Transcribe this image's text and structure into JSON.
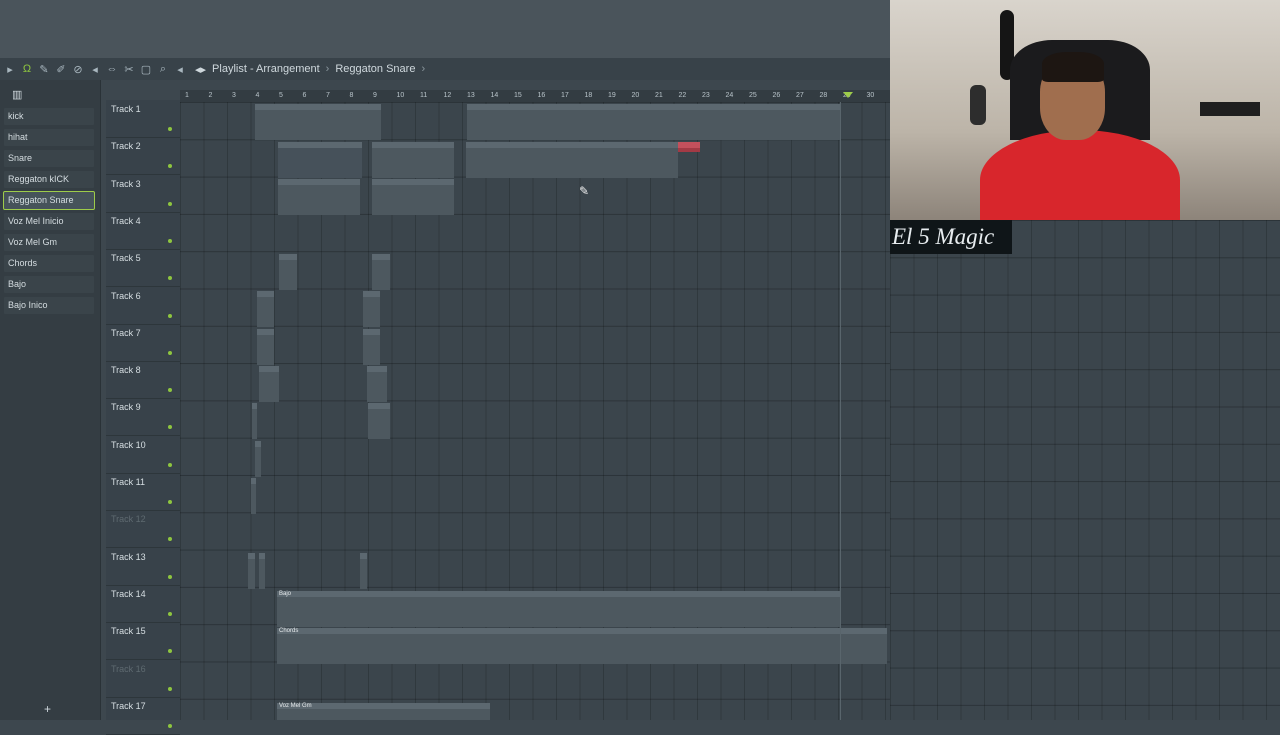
{
  "window": {
    "breadcrumbs": [
      "Playlist - Arrangement",
      "Reggaton Snare"
    ]
  },
  "browser": {
    "header_icon": "piano-roll-icon",
    "items": [
      {
        "label": "kick",
        "active": false
      },
      {
        "label": "hihat",
        "active": false
      },
      {
        "label": "Snare",
        "active": false
      },
      {
        "label": "Reggaton kICK",
        "active": false
      },
      {
        "label": "Reggaton Snare",
        "active": true
      },
      {
        "label": "Voz Mel Inicio",
        "active": false
      },
      {
        "label": "Voz Mel Gm",
        "active": false
      },
      {
        "label": "Chords",
        "active": false
      },
      {
        "label": "Bajo",
        "active": false
      },
      {
        "label": "Bajo Inico",
        "active": false
      }
    ],
    "add_label": "+"
  },
  "tracks": [
    {
      "name": "Track 1",
      "muted": false
    },
    {
      "name": "Track 2",
      "muted": false
    },
    {
      "name": "Track 3",
      "muted": false
    },
    {
      "name": "Track 4",
      "muted": false
    },
    {
      "name": "Track 5",
      "muted": false
    },
    {
      "name": "Track 6",
      "muted": false
    },
    {
      "name": "Track 7",
      "muted": false
    },
    {
      "name": "Track 8",
      "muted": false
    },
    {
      "name": "Track 9",
      "muted": false
    },
    {
      "name": "Track 10",
      "muted": false
    },
    {
      "name": "Track 11",
      "muted": false
    },
    {
      "name": "Track 12",
      "muted": true
    },
    {
      "name": "Track 13",
      "muted": false
    },
    {
      "name": "Track 14",
      "muted": false
    },
    {
      "name": "Track 15",
      "muted": false
    },
    {
      "name": "Track 16",
      "muted": true
    },
    {
      "name": "Track 17",
      "muted": false
    }
  ],
  "ruler": {
    "bars": [
      "1",
      "2",
      "3",
      "4",
      "5",
      "6",
      "7",
      "8",
      "9",
      "10",
      "11",
      "12",
      "13",
      "14",
      "15",
      "16",
      "17",
      "18",
      "19",
      "20",
      "21",
      "22",
      "23",
      "24",
      "25",
      "26",
      "27",
      "28",
      "29",
      "30"
    ]
  },
  "clip_labels": {
    "bajo": "Bajo",
    "chords": "Chords",
    "voz_mel_gm": "Voz Mel Gm"
  },
  "webcam": {
    "caption": "El 5 Magic"
  },
  "colors": {
    "accent": "#9ecc4a",
    "selected_clip": "#a33a45"
  }
}
